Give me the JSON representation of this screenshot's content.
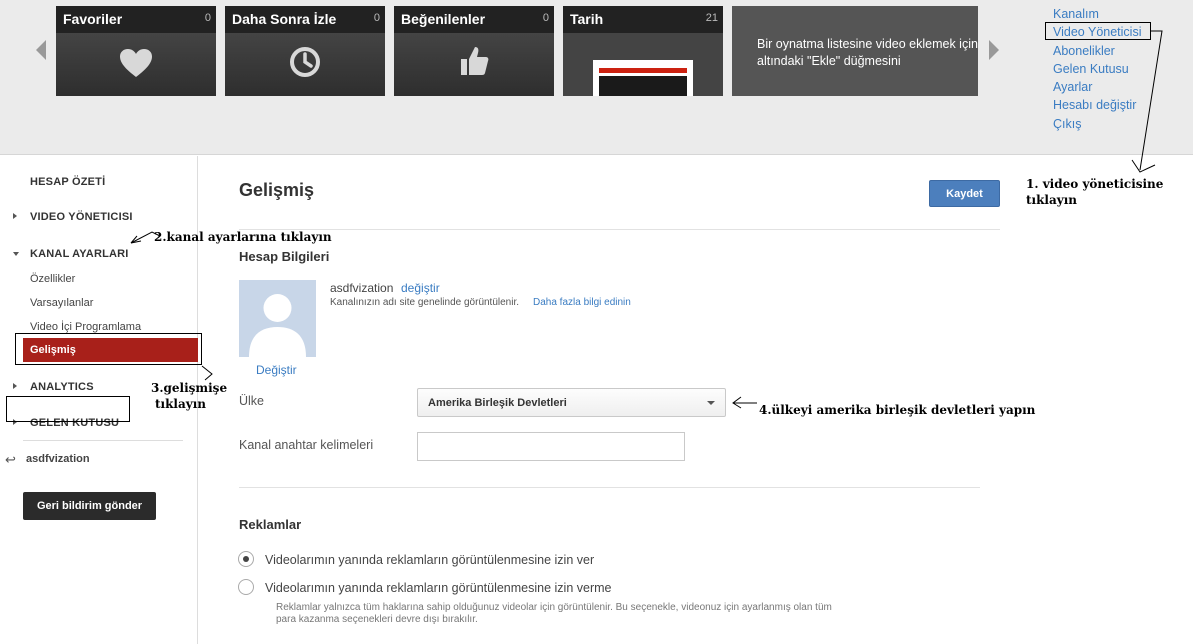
{
  "guide": {
    "tiles": [
      {
        "title": "Favoriler",
        "count": "0",
        "icon": "heart-icon"
      },
      {
        "title": "Daha Sonra İzle",
        "count": "0",
        "icon": "clock-icon"
      },
      {
        "title": "Beğenilenler",
        "count": "0",
        "icon": "thumbs-up-icon"
      },
      {
        "title": "Tarih",
        "count": "21",
        "icon": "history-thumbnail"
      }
    ],
    "message": "Bir oynatma listesine video eklemek için oynatıcının altındaki \"Ekle\" düğmesini"
  },
  "user_menu": {
    "items": [
      "Kanalım",
      "Video Yöneticisi",
      "Abonelikler",
      "Gelen Kutusu",
      "Ayarlar",
      "Hesabı değiştir",
      "Çıkış"
    ]
  },
  "sidebar": {
    "hesap_ozeti": "HESAP ÖZETİ",
    "video_yoneticisi": "VIDEO YÖNETICISI",
    "kanal_ayarlari": "KANAL AYARLARI",
    "subitems": [
      "Özellikler",
      "Varsayılanlar",
      "Video İçi Programlama",
      "Gelişmiş"
    ],
    "analytics": "ANALYTICS",
    "gelen_kutusu": "GELEN KUTUSU",
    "username": "asdfvization",
    "feedback_button": "Geri bildirim gönder"
  },
  "main": {
    "title": "Gelişmiş",
    "save_button": "Kaydet",
    "account_section": "Hesap Bilgileri",
    "account_name": "asdfvization",
    "change_link": "değiştir",
    "account_desc": "Kanalınızın adı site genelinde görüntülenir.",
    "learn_more": "Daha fazla bilgi edinin",
    "avatar_change": "Değiştir",
    "country_label": "Ülke",
    "country_value": "Amerika Birleşik Devletleri",
    "keywords_label": "Kanal anahtar kelimeleri",
    "keywords_value": "",
    "ads_section": "Reklamlar",
    "ads_option_allow": "Videolarımın yanında reklamların görüntülenmesine izin ver",
    "ads_option_deny": "Videolarımın yanında reklamların görüntülenmesine izin verme",
    "ads_selected": "allow",
    "ads_note": "Reklamlar yalnızca tüm haklarına sahip olduğunuz videolar için görüntülenir. Bu seçenekle, videonuz için ayarlanmış olan tüm para kazanma seçenekleri devre dışı bırakılır."
  },
  "annotations": {
    "step1_line1": "1. video yöneticisine",
    "step1_line2": "tıklayın",
    "step2": "2.kanal ayarlarına tıklayın",
    "step3_line1": "3.gelişmişe",
    "step3_line2": "tıklayın",
    "step4": "4.ülkeyi amerika birleşik devletleri yapın"
  },
  "colors": {
    "accent_active": "#a8201a",
    "save_button": "#4c7fbd",
    "link": "#3a7cc2"
  }
}
